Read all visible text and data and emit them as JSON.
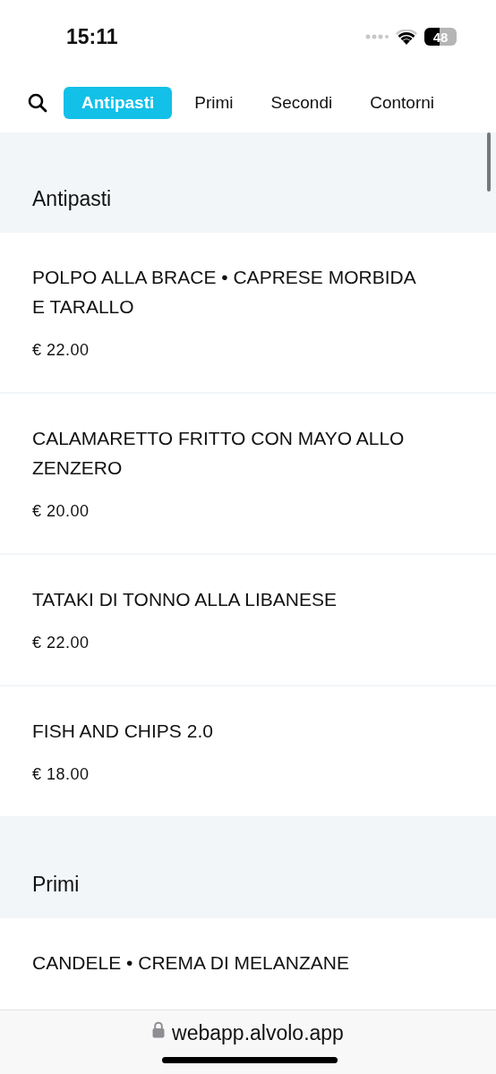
{
  "status_bar": {
    "time": "15:11",
    "battery": "48"
  },
  "tabs": [
    {
      "label": "Antipasti",
      "selected": true
    },
    {
      "label": "Primi",
      "selected": false
    },
    {
      "label": "Secondi",
      "selected": false
    },
    {
      "label": "Contorni",
      "selected": false
    }
  ],
  "sections": [
    {
      "title": "Antipasti",
      "items": [
        {
          "name": "POLPO ALLA BRACE • CAPRESE MORBIDA E TARALLO",
          "price": "€ 22.00"
        },
        {
          "name": "CALAMARETTO FRITTO CON MAYO ALLO ZENZERO",
          "price": "€ 20.00"
        },
        {
          "name": "TATAKI DI TONNO ALLA LIBANESE",
          "price": "€ 22.00"
        },
        {
          "name": "FISH AND CHIPS 2.0",
          "price": "€ 18.00"
        }
      ]
    },
    {
      "title": "Primi",
      "items": [
        {
          "name": "CANDELE • CREMA DI MELANZANE"
        }
      ]
    }
  ],
  "address_bar": {
    "url": "webapp.alvolo.app"
  }
}
